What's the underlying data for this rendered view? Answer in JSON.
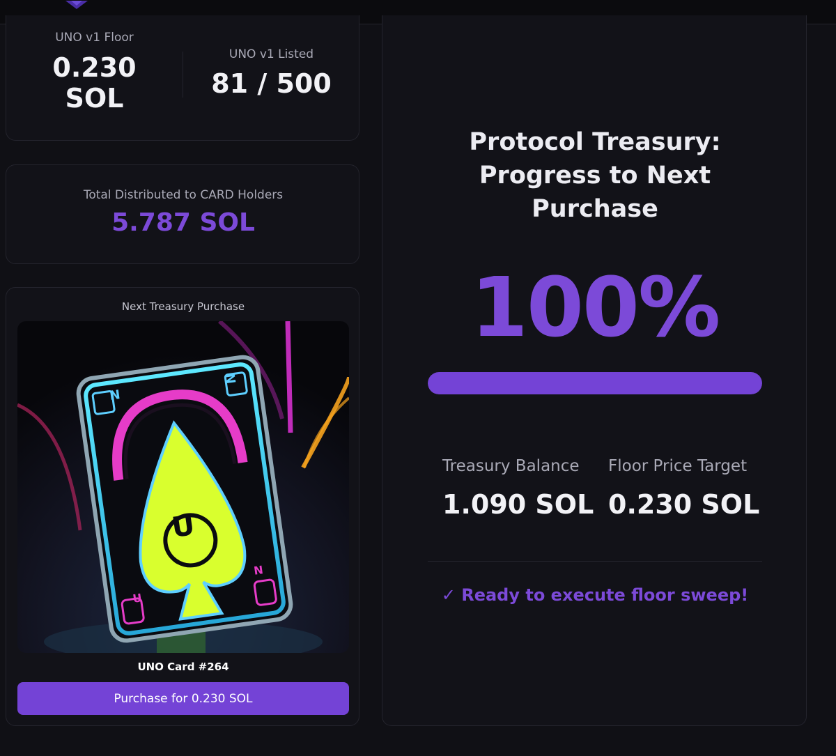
{
  "stats": {
    "floor_label": "UNO v1 Floor",
    "floor_value_line1": "0.230",
    "floor_value_line2": "SOL",
    "listed_label": "UNO v1 Listed",
    "listed_value": "81 / 500"
  },
  "distribution": {
    "label": "Total Distributed to CARD Holders",
    "value": "5.787 SOL"
  },
  "next_purchase": {
    "title": "Next Treasury Purchase",
    "card_name": "UNO Card #264",
    "button_label": "Purchase for 0.230 SOL",
    "card_letters": {
      "n": "N",
      "u": "U",
      "n_rotated": "N",
      "u_small": "U",
      "n_small": "N"
    }
  },
  "treasury": {
    "title_line1": "Protocol Treasury:",
    "title_line2": "Progress to Next",
    "title_line3": "Purchase",
    "percent_label": "100%",
    "progress": 1.0,
    "balance_label": "Treasury Balance",
    "balance_value": "1.090 SOL",
    "target_label": "Floor Price Target",
    "target_value": "0.230 SOL",
    "ready_text": "✓ Ready to execute floor sweep!"
  },
  "colors": {
    "accent": "#7443d6",
    "accent_text": "#7c4ad8",
    "background": "#101015",
    "panel": "#121218"
  }
}
